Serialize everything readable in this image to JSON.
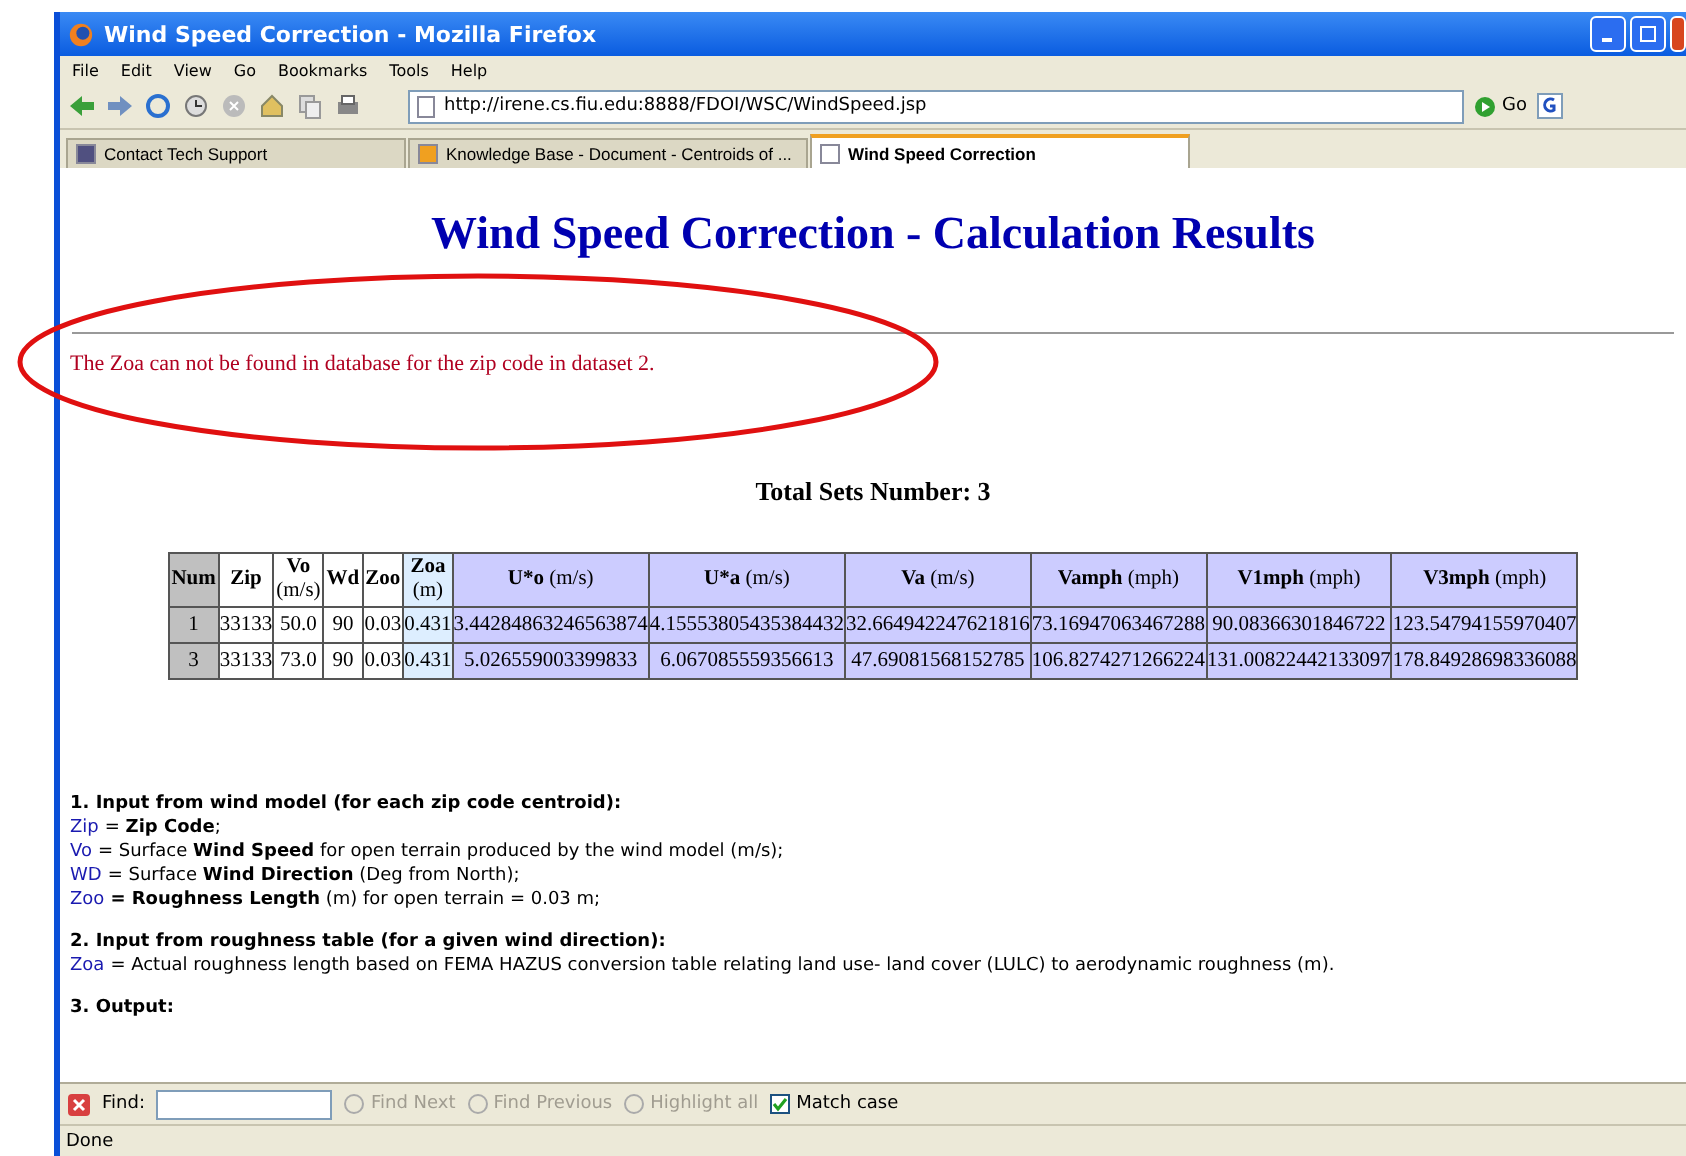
{
  "window": {
    "title": "Wind Speed Correction - Mozilla Firefox"
  },
  "menu": [
    "File",
    "Edit",
    "View",
    "Go",
    "Bookmarks",
    "Tools",
    "Help"
  ],
  "toolbar": {
    "url": "http://irene.cs.fiu.edu:8888/FDOI/WSC/WindSpeed.jsp",
    "go": "Go"
  },
  "tabs": [
    {
      "label": "Contact Tech Support",
      "selected": false
    },
    {
      "label": "Knowledge Base - Document - Centroids of ...",
      "selected": false
    },
    {
      "label": "Wind Speed Correction",
      "selected": true
    }
  ],
  "page": {
    "heading": "Wind Speed Correction - Calculation Results",
    "error": "The Zoa can not be found in database for the zip code in dataset 2.",
    "total": "Total Sets Number: 3",
    "table": {
      "columns": [
        {
          "name": "Num",
          "color": "#c0c0c0"
        },
        {
          "name": "Zip",
          "color": "#ffffff"
        },
        {
          "name": "Vo",
          "unit": "(m/s)",
          "color": "#ffffff"
        },
        {
          "name": "Wd",
          "color": "#ffffff"
        },
        {
          "name": "Zoo",
          "color": "#ffffff"
        },
        {
          "name": "Zoa",
          "unit": "(m)",
          "color": "#ddeeff"
        },
        {
          "name": "U*o",
          "unit": "(m/s)",
          "color": "#ccccff"
        },
        {
          "name": "U*a",
          "unit": "(m/s)",
          "color": "#ccccff"
        },
        {
          "name": "Va",
          "unit": "(m/s)",
          "color": "#ccccff"
        },
        {
          "name": "Vamph",
          "unit": "(mph)",
          "color": "#ccccff"
        },
        {
          "name": "V1mph",
          "unit": "(mph)",
          "color": "#ccccff"
        },
        {
          "name": "V3mph",
          "unit": "(mph)",
          "color": "#ccccff"
        }
      ],
      "rows": [
        [
          "1",
          "33133",
          "50.0",
          "90",
          "0.03",
          "0.431",
          "3.44284863246563874",
          "4.15553805435384432",
          "32.664942247621816",
          "73.16947063467288",
          "90.08366301846722",
          "123.54794155970407"
        ],
        [
          "3",
          "33133",
          "73.0",
          "90",
          "0.03",
          "0.431",
          "5.026559003399833",
          "6.067085559356613",
          "47.69081568152785",
          "106.8274271266224",
          "131.00822442133097",
          "178.84928698336088"
        ]
      ]
    },
    "sections": [
      {
        "title": "1. Input from wind model (for each zip code centroid):",
        "lines": [
          {
            "term": "Zip",
            "text": "= **Zip Code**;"
          },
          {
            "term": "Vo",
            "text": "= Surface **Wind Speed** for open terrain produced by the wind model (m/s);"
          },
          {
            "term": "WD",
            "text": "= Surface **Wind Direction** (Deg from North);"
          },
          {
            "term": "Zoo",
            "text": "**= Roughness Length** (m) for open terrain = 0.03 m;"
          }
        ]
      },
      {
        "title": "2. Input from roughness table (for a given wind direction):",
        "lines": [
          {
            "term": "Zoa",
            "text": "= Actual roughness length based on FEMA HAZUS conversion table relating land use- land cover (LULC) to aerodynamic roughness (m)."
          }
        ]
      },
      {
        "title": "3. Output:"
      }
    ]
  },
  "find_bar": {
    "label": "Find:",
    "buttons": [
      {
        "label": "Find Next",
        "disabled": true
      },
      {
        "label": "Find Previous",
        "disabled": true
      },
      {
        "label": "Highlight all",
        "disabled": true
      }
    ],
    "match_case": {
      "label": "Match case",
      "checked": true
    }
  },
  "status_bar": "Done"
}
